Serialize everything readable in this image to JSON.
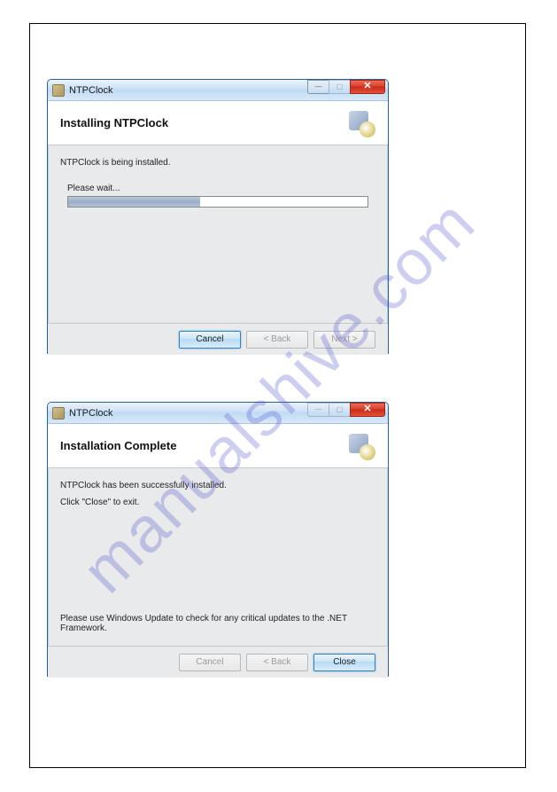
{
  "watermark": "manualshive.com",
  "window1": {
    "title": "NTPClock",
    "header": "Installing NTPClock",
    "body_text": "NTPClock is being installed.",
    "please_wait": "Please wait...",
    "progress_percent": 44,
    "buttons": {
      "cancel": "Cancel",
      "back": "< Back",
      "next": "Next >"
    }
  },
  "window2": {
    "title": "NTPClock",
    "header": "Installation Complete",
    "body_text1": "NTPClock has been successfully installed.",
    "body_text2": "Click \"Close\" to exit.",
    "footer_note": "Please use Windows Update to check for any critical updates to the .NET Framework.",
    "buttons": {
      "cancel": "Cancel",
      "back": "< Back",
      "close": "Close"
    }
  },
  "win_controls": {
    "minimize": "—",
    "maximize": "▢",
    "close": "✕"
  }
}
